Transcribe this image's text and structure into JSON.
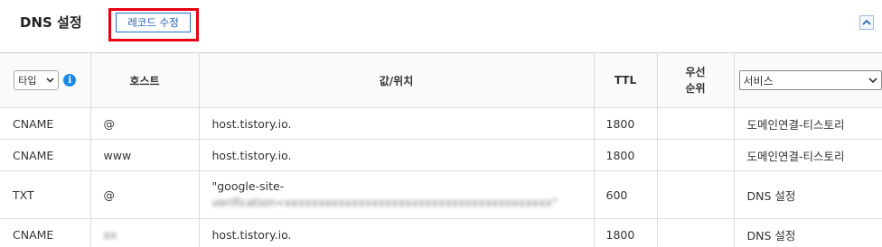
{
  "header": {
    "title": "DNS 설정",
    "edit_button_label": "레코드 수정",
    "collapse_icon": "chevron-up-icon",
    "highlight_color": "#e60012",
    "accent_color": "#1f6fd1"
  },
  "table": {
    "columns": {
      "type_select_value": "타입",
      "info_icon": "info-icon",
      "host": "호스트",
      "value": "값/위치",
      "ttl": "TTL",
      "priority": "우선\n순위",
      "service_select_value": "서비스"
    },
    "rows": [
      {
        "type": "CNAME",
        "host": "@",
        "value": "host.tistory.io.",
        "ttl": "1800",
        "priority": "",
        "service": "도메인연결-티스토리"
      },
      {
        "type": "CNAME",
        "host": "www",
        "value": "host.tistory.io.",
        "ttl": "1800",
        "priority": "",
        "service": "도메인연결-티스토리"
      },
      {
        "type": "TXT",
        "host": "@",
        "value": "\"google-site-",
        "value_redacted": "verification=xxxxxxxxxxxxxxxxxxxxxxxxxxxxxxxxxxxxxxxx\"",
        "ttl": "600",
        "priority": "",
        "service": "DNS 설정"
      },
      {
        "type": "CNAME",
        "host_redacted": "xx",
        "value": "host.tistory.io.",
        "ttl": "1800",
        "priority": "",
        "service": "DNS 설정"
      }
    ]
  }
}
